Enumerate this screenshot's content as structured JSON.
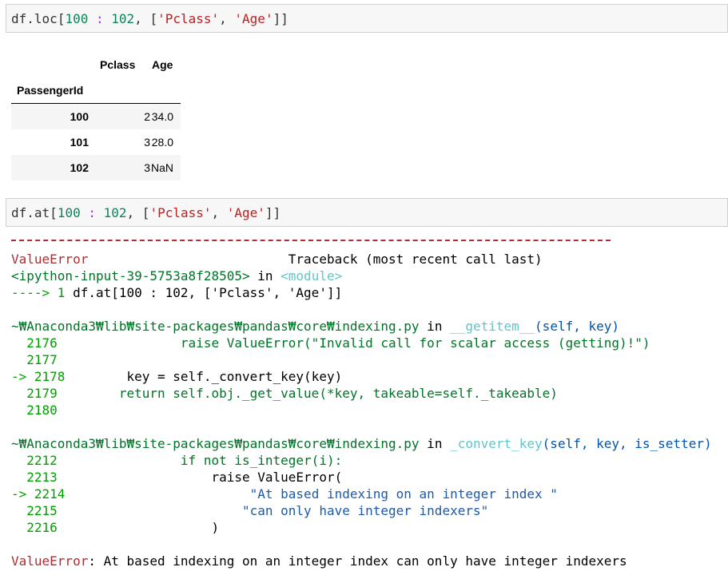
{
  "cell1": {
    "parts": [
      "df",
      ".",
      "loc",
      "[",
      "100",
      " : ",
      "102",
      ", ",
      "[",
      "'Pclass'",
      ", ",
      "'Age'",
      "]",
      "]"
    ]
  },
  "dataframe": {
    "columns": [
      "Pclass",
      "Age"
    ],
    "index_name": "PassengerId",
    "rows": [
      {
        "index": "100",
        "pclass": "2",
        "age": "34.0"
      },
      {
        "index": "101",
        "pclass": "3",
        "age": "28.0"
      },
      {
        "index": "102",
        "pclass": "3",
        "age": "NaN"
      }
    ]
  },
  "cell2": {
    "parts": [
      "df",
      ".",
      "at",
      "[",
      "100",
      " : ",
      "102",
      ", ",
      "[",
      "'Pclass'",
      ", ",
      "'Age'",
      "]",
      "]"
    ]
  },
  "traceback": {
    "dashes": "---------------------------------------------------------------------------",
    "error_type": "ValueError",
    "header_right": "Traceback (most recent call last)",
    "input_ref": "<ipython-input-39-5753a8f28505>",
    "in_word": " in ",
    "module": "<module>",
    "arrow_line_prefix": "----> 1 ",
    "arrow_line_code": "df.at[100 : 102, ['Pclass', 'Age']]",
    "frame1": {
      "path": "~₩Anaconda3₩lib₩site-packages₩pandas₩core₩indexing.py",
      "in_word": " in ",
      "func": "__getitem__",
      "args": "(self, key)",
      "lines": [
        {
          "no": "2176",
          "arrow": false,
          "indent": "                ",
          "code": "raise ValueError(\"Invalid call for scalar access (getting)!\")"
        },
        {
          "no": "2177",
          "arrow": false,
          "indent": "",
          "code": ""
        },
        {
          "no": "2178",
          "arrow": true,
          "indent": "        ",
          "code": "key = self._convert_key(key)"
        },
        {
          "no": "2179",
          "arrow": false,
          "indent": "        ",
          "code": "return self.obj._get_value(*key, takeable=self._takeable)"
        },
        {
          "no": "2180",
          "arrow": false,
          "indent": "",
          "code": ""
        }
      ]
    },
    "frame2": {
      "path": "~₩Anaconda3₩lib₩site-packages₩pandas₩core₩indexing.py",
      "in_word": " in ",
      "func": "_convert_key",
      "args": "(self, key, is_setter)",
      "lines": [
        {
          "no": "2212",
          "arrow": false,
          "indent": "                ",
          "code": "if not is_integer(i):"
        },
        {
          "no": "2213",
          "arrow": false,
          "indent": "                    ",
          "code": "raise ValueError("
        },
        {
          "no": "2214",
          "arrow": true,
          "indent": "                        ",
          "code": "\"At based indexing on an integer index \""
        },
        {
          "no": "2215",
          "arrow": false,
          "indent": "                        ",
          "code": "\"can only have integer indexers\""
        },
        {
          "no": "2216",
          "arrow": false,
          "indent": "                    ",
          "code": ")"
        }
      ]
    },
    "final_error_type": "ValueError",
    "final_message": ": At based indexing on an integer index can only have integer indexers"
  },
  "colors": {
    "error_red": "#b22b31",
    "lineno_green": "#00a000",
    "string_blue": "#1e5aa8",
    "cell_bg": "#f7f7f7"
  }
}
